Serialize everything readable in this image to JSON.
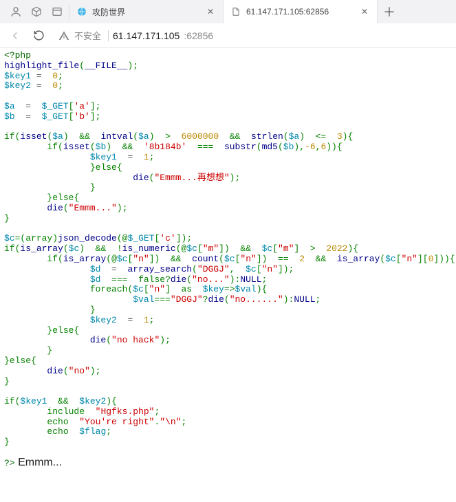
{
  "tabbar": {
    "tabs": [
      {
        "favicon": "globe-blue",
        "title": "攻防世界"
      },
      {
        "favicon": "page",
        "title": "61.147.171.105:62856"
      }
    ]
  },
  "addr": {
    "insecure_label": "不安全",
    "host": "61.147.171.105",
    "port": ":62856"
  },
  "php": {
    "open_tag": "<?php",
    "highlight_file": "highlight_file",
    "FILE": "__FILE__",
    "key1": "$key1",
    "key2": "$key2",
    "zero": "0",
    "semi": ";",
    "a": "$a",
    "b": "$b",
    "c": "$c",
    "d": "$d",
    "GET": "$_GET",
    "idx_a": "'a'",
    "idx_b": "'b'",
    "idx_c": "'c'",
    "idx_m": "\"m\"",
    "idx_n": "\"n\"",
    "isset": "isset",
    "intval": "intval",
    "strlen": "strlen",
    "substr": "substr",
    "md5": "md5",
    "die": "die",
    "json_decode": "json_decode",
    "is_array": "is_array",
    "is_numeric": "is_numeric",
    "count": "count",
    "array_search": "array_search",
    "foreach": "foreach",
    "as": "as",
    "else": "else",
    "if": "if",
    "include": "include",
    "echo": "echo",
    "NULL": "NULL",
    "false": "false",
    "six_million": "6000000",
    "three": "3",
    "two": "2",
    "one": "1",
    "year": "2022",
    "neg6": "-6",
    "six": "6",
    "hash": "'8b184b'",
    "emmm_think": "\"Emmm...再想想\"",
    "emmm_dots": "\"Emmm...\"",
    "dggj": "\"DGGJ\"",
    "no_dots3": "\"no...\"",
    "no_dots6": "\"no......\"",
    "no_hack": "\"no  hack\"",
    "no": "\"no\"",
    "hgfks": "\"Hgfks.php\"",
    "youre_right": "\"You're  right\"",
    "nl": "\"\\n\"",
    "flag": "$flag",
    "key": "$key",
    "val": "$val",
    "arrow": "=>",
    "at": "@",
    "amp": "&&",
    "gt": ">",
    "lt": "<=",
    "eqeq": "==",
    "eqeqeq": "===",
    "not": "!",
    "array_cast": "(array)",
    "close_tag": "?>",
    "output": "Emmm..."
  }
}
